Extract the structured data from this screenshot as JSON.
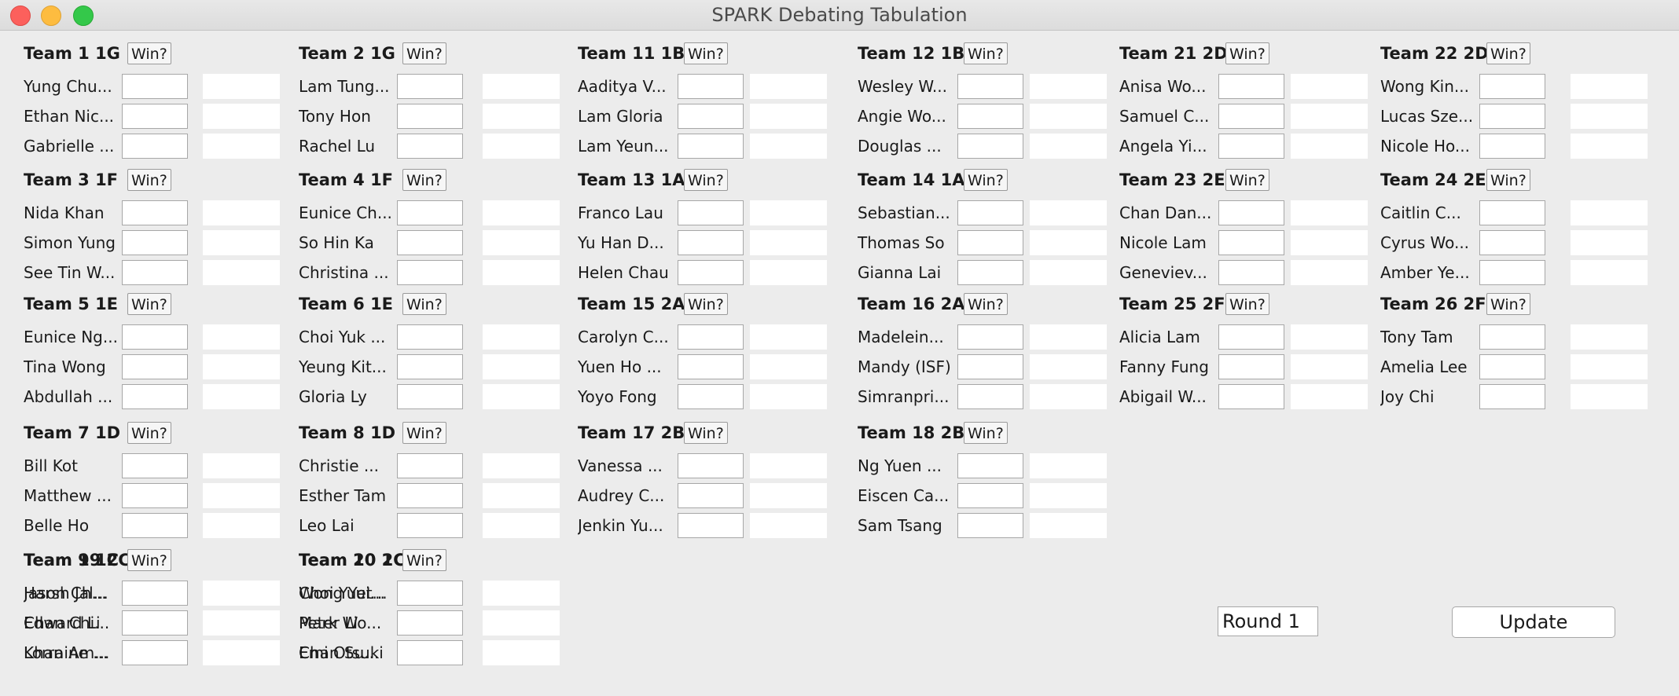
{
  "window": {
    "title": "SPARK Debating Tabulation"
  },
  "win_label": "Win?",
  "teams": [
    {
      "name": "Team 1 1G",
      "members": [
        "Yung Chu...",
        "Ethan Nic...",
        "Gabrielle ..."
      ]
    },
    {
      "name": "Team 2 1G",
      "members": [
        "Lam Tung...",
        "Tony Hon",
        "Rachel Lu"
      ]
    },
    {
      "name": "Team 11 1B",
      "members": [
        "Aaditya V...",
        "Lam Gloria",
        "Lam Yeun..."
      ]
    },
    {
      "name": "Team 12 1B",
      "members": [
        "Wesley W...",
        "Angie Wo...",
        "Douglas ..."
      ]
    },
    {
      "name": "Team 21 2D",
      "members": [
        "Anisa Wo...",
        "Samuel C...",
        "Angela Yi..."
      ]
    },
    {
      "name": "Team 22 2D",
      "members": [
        "Wong Kin...",
        "Lucas Sze...",
        "Nicole Ho..."
      ]
    },
    {
      "name": "Team 3 1F",
      "members": [
        "Nida Khan",
        "Simon Yung",
        "See Tin W..."
      ]
    },
    {
      "name": "Team 4 1F",
      "members": [
        "Eunice Ch...",
        "So Hin Ka",
        "Christina ..."
      ]
    },
    {
      "name": "Team 13 1A",
      "members": [
        "Franco Lau",
        "Yu Han D...",
        "Helen Chau"
      ]
    },
    {
      "name": "Team 14 1A",
      "members": [
        "Sebastian...",
        "Thomas So",
        "Gianna Lai"
      ]
    },
    {
      "name": "Team 23 2E",
      "members": [
        "Chan Dan...",
        "Nicole Lam",
        "Geneviev..."
      ]
    },
    {
      "name": "Team 24 2E",
      "members": [
        "Caitlin C...",
        "Cyrus Wo...",
        "Amber Ye..."
      ]
    },
    {
      "name": "Team 5 1E",
      "members": [
        "Eunice Ng...",
        "Tina Wong",
        "Abdullah ..."
      ]
    },
    {
      "name": "Team 6 1E",
      "members": [
        "Choi Yuk ...",
        "Yeung Kit...",
        "Gloria Ly"
      ]
    },
    {
      "name": "Team 15 2A",
      "members": [
        "Carolyn C...",
        "Yuen Ho ...",
        "Yoyo Fong"
      ]
    },
    {
      "name": "Team 16 2A",
      "members": [
        "Madelein...",
        "Mandy (ISF)",
        "Simranpri..."
      ]
    },
    {
      "name": "Team 25 2F",
      "members": [
        "Alicia Lam",
        "Fanny Fung",
        "Abigail W..."
      ]
    },
    {
      "name": "Team 26 2F",
      "members": [
        "Tony Tam",
        "Amelia Lee",
        "Joy Chi"
      ]
    },
    {
      "name": "Team 7 1D",
      "members": [
        "Bill Kot",
        "Matthew ...",
        "Belle Ho"
      ]
    },
    {
      "name": "Team 8 1D",
      "members": [
        "Christie ...",
        "Esther Tam",
        "Leo Lai"
      ]
    },
    {
      "name": "Team 17 2B",
      "members": [
        "Vanessa ...",
        "Audrey C...",
        "Jenkin Yu..."
      ]
    },
    {
      "name": "Team 18 2B",
      "members": [
        "Ng Yuen ...",
        "Eiscen Ca...",
        "Sam Tsang"
      ]
    },
    {
      "name": "Team 9 1C",
      "members": [
        "Jason Ch...",
        "Chan Chi...",
        "Lorraine ..."
      ]
    },
    {
      "name": "Team 10 1C",
      "members": [
        "Choi Yuet...",
        "Mark Wo...",
        "Emi Otsuki"
      ]
    },
    {
      "name": "Team 19 2C",
      "members": [
        "Harsh Jal...",
        "Edward Li",
        "Khan Am..."
      ]
    },
    {
      "name": "Team 20 2C",
      "members": [
        "Wong Yui...",
        "Peter Li",
        "Chan Su..."
      ]
    }
  ],
  "round": {
    "value": "Round 1"
  },
  "update": {
    "label": "Update"
  }
}
